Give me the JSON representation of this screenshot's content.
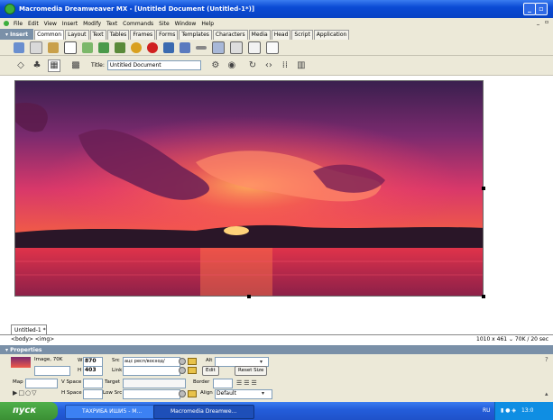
{
  "window": {
    "title": "Macromedia Dreamweaver MX - [Untitled Document (Untitled-1*)]",
    "minimize_label": "_",
    "restore_label": "▫",
    "close_label": "×",
    "doc_minimize": "_",
    "doc_restore": "▫"
  },
  "menubar": [
    "File",
    "Edit",
    "View",
    "Insert",
    "Modify",
    "Text",
    "Commands",
    "Site",
    "Window",
    "Help"
  ],
  "insert_panel": {
    "title": "▾ Insert",
    "tabs": [
      "Common",
      "Layout",
      "Text",
      "Tables",
      "Frames",
      "Forms",
      "Templates",
      "Characters",
      "Media",
      "Head",
      "Script",
      "Application"
    ],
    "active_tab": "Common"
  },
  "doc_toolbar": {
    "title_label": "Title:",
    "title_value": "Untitled Document"
  },
  "document": {
    "tab_label": "Untitled-1 *",
    "tag_selector": "<body> <img>",
    "status_info": "1010 x 461 ⌄ 70K / 20 sec"
  },
  "properties": {
    "header": "▾ Properties",
    "image_label": "Image, 70K",
    "w_label": "W",
    "w_value": "870",
    "h_label": "H",
    "h_value": "403",
    "src_label": "Src",
    "src_value": "ацс респ/восход/Закат.jpg",
    "link_label": "Link",
    "alt_label": "Alt",
    "edit_label": "Edit",
    "reset_size_label": "Reset Size",
    "map_label": "Map",
    "vspace_label": "V Space",
    "target_label": "Target",
    "border_label": "Border",
    "hspace_label": "H Space",
    "lowsrc_label": "Low Src",
    "align_label": "Align",
    "align_value": "Default"
  },
  "taskbar": {
    "start_label": "пуск",
    "tasks": [
      "ТАХРИБА ИШИ5 - М...",
      "Macromedia Dreamwe..."
    ],
    "lang": "RU",
    "clock": "13:0"
  }
}
